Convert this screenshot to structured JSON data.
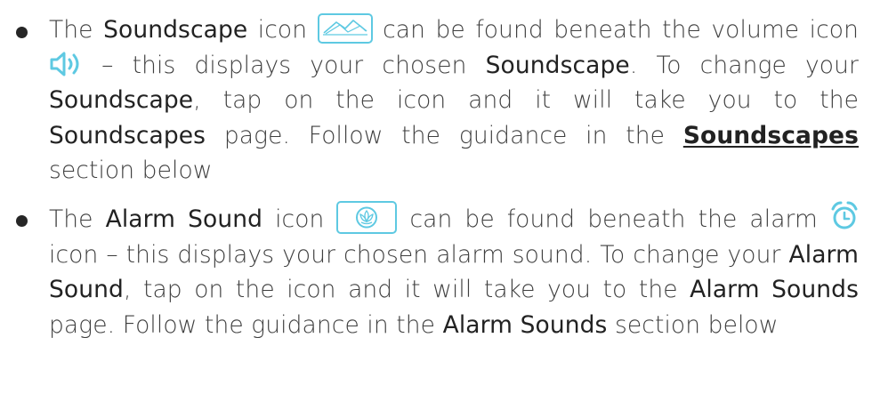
{
  "bullets": [
    {
      "p1": "The ",
      "k1": "Soundscape",
      "p2": " icon ",
      "p3": " can be found beneath the volume icon ",
      "p4": " – this displays your chosen ",
      "k2": "Soundscape",
      "p5": ". To change your ",
      "k3": "Soundscape",
      "p6": ", tap on the icon and it will take you to the ",
      "k4": "Soundscapes",
      "p7": " page. Follow the guidance in the ",
      "link": "Soundscapes",
      "p8": " section below"
    },
    {
      "p1": "The ",
      "k1": "Alarm Sound",
      "p2": " icon ",
      "p3": " can be found beneath the alarm ",
      "p4": " icon – this displays your chosen alarm sound. To change your ",
      "k2": "Alarm Sound",
      "p5": ", tap on the icon and it will take you to the ",
      "k3": "Alarm Sounds",
      "p6": " page. Follow the guidance in the ",
      "k4": "Alarm Sounds",
      "p7": " section below"
    }
  ],
  "icons": {
    "soundscape": "soundscape-icon",
    "volume": "volume-icon",
    "alarm_sound": "lotus-icon",
    "alarm": "alarm-clock-icon"
  },
  "colors": {
    "accent": "#5ec9e2",
    "text": "#3f3f3f",
    "bullet": "#262626"
  }
}
